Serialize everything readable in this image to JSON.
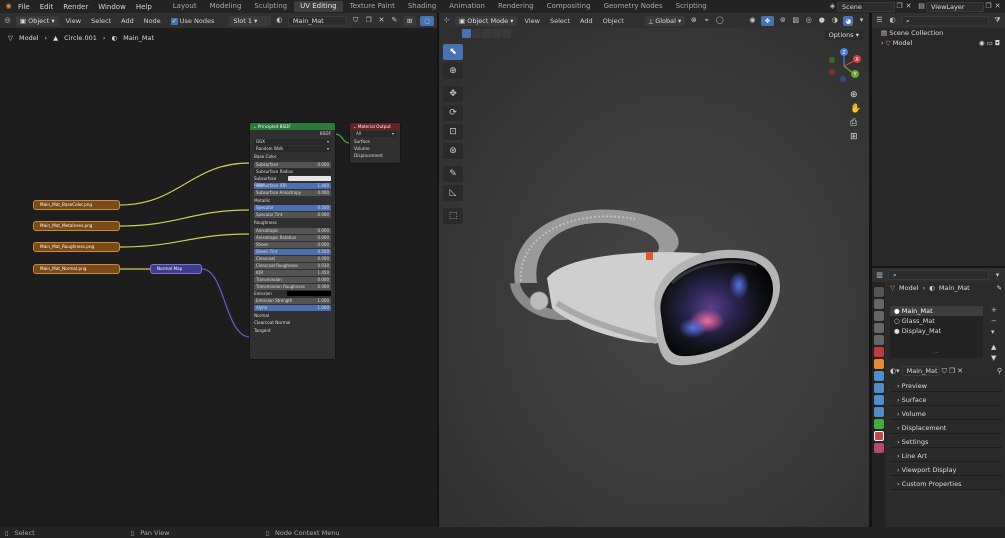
{
  "menubar": {
    "items": [
      "File",
      "Edit",
      "Render",
      "Window",
      "Help"
    ],
    "workspaces": [
      {
        "label": "Layout",
        "active": false
      },
      {
        "label": "Modeling",
        "active": false
      },
      {
        "label": "Sculpting",
        "active": false
      },
      {
        "label": "UV Editing",
        "active": true
      },
      {
        "label": "Texture Paint",
        "active": false
      },
      {
        "label": "Shading",
        "active": false
      },
      {
        "label": "Animation",
        "active": false
      },
      {
        "label": "Rendering",
        "active": false
      },
      {
        "label": "Compositing",
        "active": false
      },
      {
        "label": "Geometry Nodes",
        "active": false
      },
      {
        "label": "Scripting",
        "active": false
      }
    ],
    "scene": "Scene",
    "view_layer": "ViewLayer"
  },
  "node_editor": {
    "object_mode": "Object",
    "menus": [
      "View",
      "Select",
      "Add",
      "Node"
    ],
    "use_nodes": "Use Nodes",
    "slot": "Slot 1",
    "material": "Main_Mat",
    "breadcrumb": [
      "Model",
      "Circle.001",
      "Main_Mat"
    ],
    "textures": [
      "Main_Mat_BaseColor.png",
      "Main_Mat_Metalness.png",
      "Main_Mat_Roughness.png",
      "Main_Mat_Normal.png"
    ],
    "normal_map_label": "Normal Map",
    "bsdf": {
      "title": "Principled BSDF",
      "output": "BSDF",
      "distribution": "GGX",
      "subsurface_method": "Random Walk",
      "rows": [
        {
          "label": "Base Color",
          "value": "",
          "kind": "socket"
        },
        {
          "label": "Subsurface",
          "value": "0.000",
          "kind": "field"
        },
        {
          "label": "Subsurface Radius",
          "value": "",
          "kind": "dropdown"
        },
        {
          "label": "Subsurface Color",
          "value": "",
          "kind": "color"
        },
        {
          "label": "Subsurface IOR",
          "value": "1.400",
          "kind": "blue"
        },
        {
          "label": "Subsurface Anisotropy",
          "value": "0.000",
          "kind": "field"
        },
        {
          "label": "Metallic",
          "value": "",
          "kind": "socket"
        },
        {
          "label": "Specular",
          "value": "0.500",
          "kind": "blue"
        },
        {
          "label": "Specular Tint",
          "value": "0.000",
          "kind": "field"
        },
        {
          "label": "Roughness",
          "value": "",
          "kind": "socket"
        },
        {
          "label": "Anisotropic",
          "value": "0.000",
          "kind": "field"
        },
        {
          "label": "Anisotropic Rotation",
          "value": "0.000",
          "kind": "field"
        },
        {
          "label": "Sheen",
          "value": "0.000",
          "kind": "field"
        },
        {
          "label": "Sheen Tint",
          "value": "0.500",
          "kind": "blue"
        },
        {
          "label": "Clearcoat",
          "value": "0.000",
          "kind": "field"
        },
        {
          "label": "Clearcoat Roughness",
          "value": "0.030",
          "kind": "field"
        },
        {
          "label": "IOR",
          "value": "1.450",
          "kind": "field"
        },
        {
          "label": "Transmission",
          "value": "0.000",
          "kind": "field"
        },
        {
          "label": "Transmission Roughness",
          "value": "0.000",
          "kind": "field"
        },
        {
          "label": "Emission",
          "value": "",
          "kind": "black"
        },
        {
          "label": "Emission Strength",
          "value": "1.000",
          "kind": "field"
        },
        {
          "label": "Alpha",
          "value": "1.000",
          "kind": "blue"
        },
        {
          "label": "Normal",
          "value": "",
          "kind": "socket"
        },
        {
          "label": "Clearcoat Normal",
          "value": "",
          "kind": "socket"
        },
        {
          "label": "Tangent",
          "value": "",
          "kind": "socket"
        }
      ]
    },
    "output_node": {
      "title": "Material Output",
      "target": "All",
      "inputs": [
        "Surface",
        "Volume",
        "Displacement"
      ]
    }
  },
  "viewport": {
    "mode": "Object Mode",
    "menus": [
      "View",
      "Select",
      "Add",
      "Object"
    ],
    "transform": "Global",
    "options": "Options"
  },
  "outliner": {
    "collection": "Scene Collection",
    "object": "Model"
  },
  "properties": {
    "object": "Model",
    "material": "Main_Mat",
    "slots": [
      "Main_Mat",
      "Glass_Mat",
      "Display_Mat"
    ],
    "material_field": "Main_Mat",
    "sections": [
      "Preview",
      "Surface",
      "Volume",
      "Displacement",
      "Settings",
      "Line Art",
      "Viewport Display",
      "Custom Properties"
    ]
  },
  "statusbar": {
    "items": [
      "Select",
      "Pan View",
      "Node Context Menu"
    ]
  },
  "colors": {
    "accent": "#4772b3",
    "bsdf_header": "#2a7a3a",
    "output_header": "#6b1f2a",
    "texture_node": "#7a4a17",
    "normal_map_node": "#3e3a8c"
  }
}
